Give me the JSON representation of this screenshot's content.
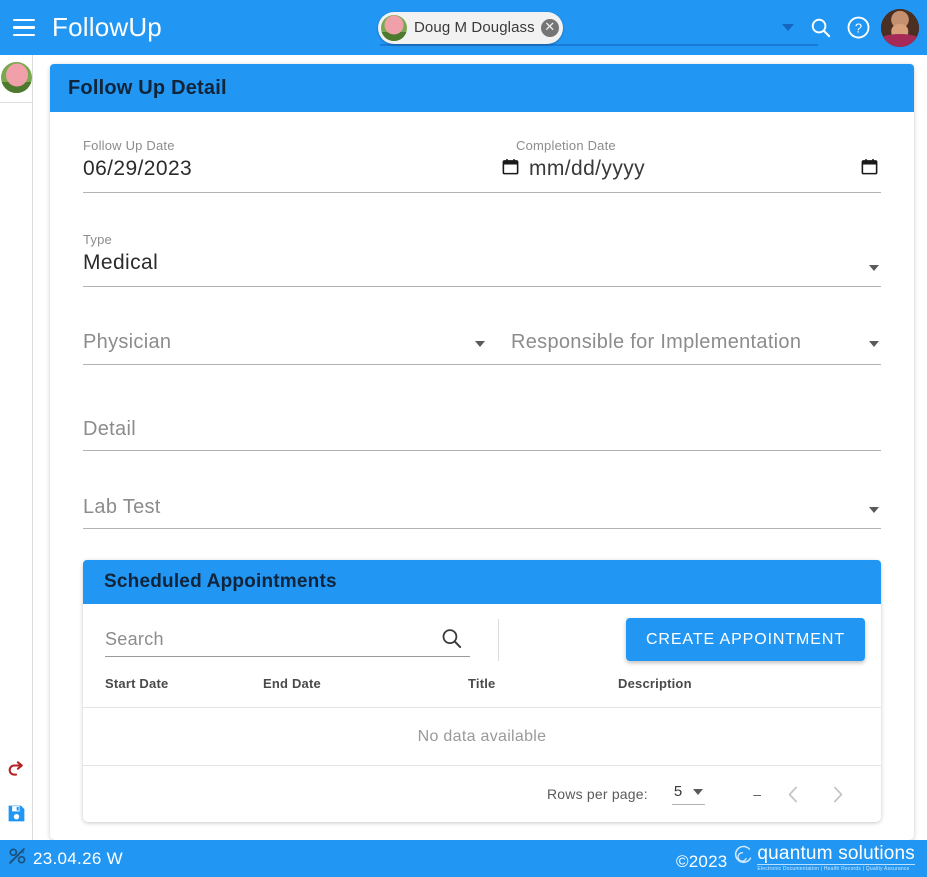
{
  "topbar": {
    "menu_icon": "hamburger-icon",
    "app_title": "FollowUp",
    "patient_chip": {
      "name": "Doug M Douglass",
      "remove_icon": "close-circle-icon",
      "avatar_icon": "patient-avatar"
    },
    "dropdown_icon": "chevron-down-icon",
    "search_icon": "search-icon",
    "help_icon": "help-circle-icon",
    "user_avatar_icon": "user-avatar"
  },
  "leftrail": {
    "patient_avatar_icon": "patient-avatar-thumb",
    "back_icon": "undo-arrow-icon",
    "save_icon": "save-floppy-icon"
  },
  "detail_card": {
    "title": "Follow Up Detail",
    "fields": {
      "follow_up_date": {
        "label": "Follow Up Date",
        "value": "06/29/2023"
      },
      "completion_date": {
        "label": "Completion Date",
        "value": "",
        "placeholder": "mm/dd/yyyy",
        "calendar_icon": "calendar-icon"
      },
      "type": {
        "label": "Type",
        "value": "Medical"
      },
      "physician": {
        "label": "Physician",
        "value": ""
      },
      "responsible": {
        "label": "Responsible for Implementation",
        "value": ""
      },
      "detail": {
        "label": "Detail",
        "value": ""
      },
      "lab_test": {
        "label": "Lab Test",
        "value": ""
      }
    }
  },
  "appointments": {
    "title": "Scheduled Appointments",
    "search_placeholder": "Search",
    "search_value": "",
    "search_icon": "search-icon",
    "create_button": "CREATE APPOINTMENT",
    "columns": [
      "Start Date",
      "End Date",
      "Title",
      "Description"
    ],
    "rows": [],
    "empty_text": "No data available",
    "paginator": {
      "rows_per_page_label": "Rows per page:",
      "rows_per_page_value": "5",
      "range_label": "–",
      "prev_icon": "chevron-left-icon",
      "next_icon": "chevron-right-icon"
    }
  },
  "footer": {
    "status_icon": "offline-slash-icon",
    "version": "23.04.26 W",
    "copyright": "©2023",
    "brand_icon": "quantum-swirl-icon",
    "brand_name": "quantum solutions",
    "brand_tagline": "Electronic Documentation  |  Health Records  |  Quality Assurance"
  },
  "colors": {
    "accent": "#2196f3",
    "header_text": "#10243a",
    "field_label": "#8c8c8c",
    "back_icon": "#b52020",
    "save_icon": "#2196f3"
  }
}
